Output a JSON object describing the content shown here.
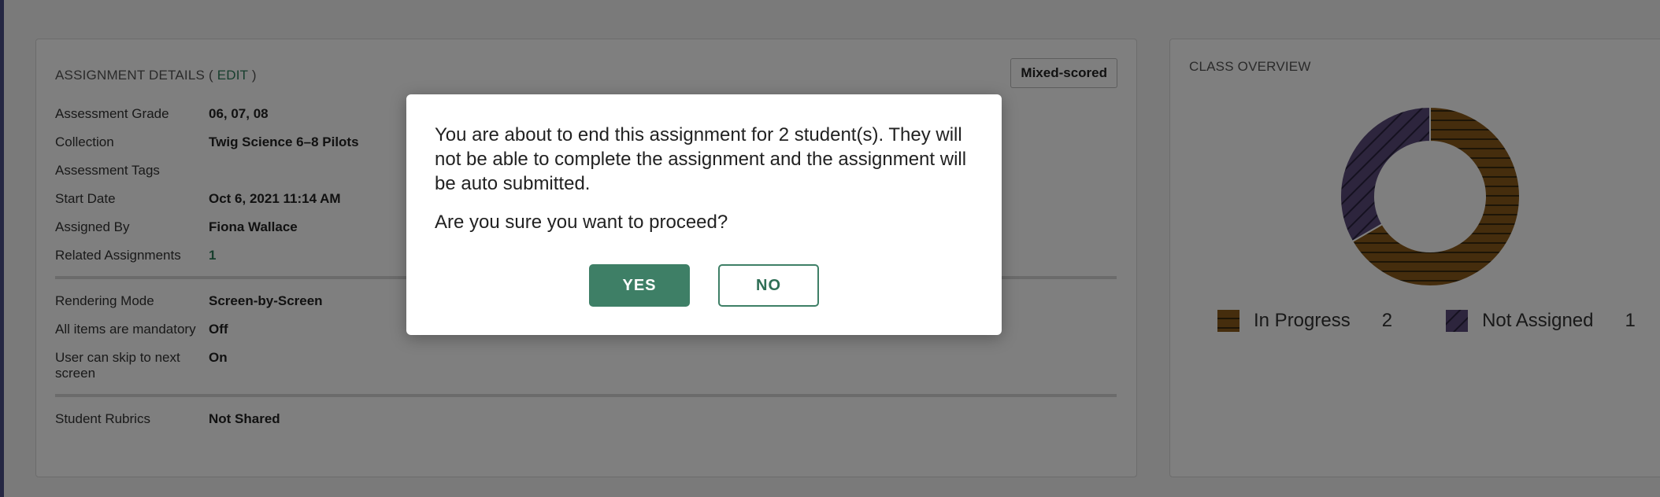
{
  "assignment_details": {
    "heading": "ASSIGNMENT DETAILS",
    "edit_open": " ( ",
    "edit_label": "EDIT",
    "edit_close": " )",
    "scoring_badge": "Mixed-scored",
    "rows": [
      {
        "label": "Assessment Grade",
        "value": "06, 07, 08"
      },
      {
        "label": "Collection",
        "value": "Twig Science 6–8 Pilots"
      },
      {
        "label": "Assessment Tags",
        "value": ""
      },
      {
        "label": "Start Date",
        "value": "Oct 6, 2021 11:14 AM"
      },
      {
        "label": "Assigned By",
        "value": "Fiona Wallace"
      },
      {
        "label": "Related Assignments",
        "value": "1"
      },
      {
        "label": "Rendering Mode",
        "value": "Screen-by-Screen"
      },
      {
        "label": "All items are mandatory",
        "value": "Off"
      },
      {
        "label": "User can skip to next screen",
        "value": "On"
      },
      {
        "label": "Student Rubrics",
        "value": "Not Shared"
      }
    ]
  },
  "class_overview": {
    "heading": "CLASS OVERVIEW",
    "chart": {
      "type": "donut",
      "segments": [
        {
          "label": "In Progress",
          "value": 2,
          "color": "#8b5a1b",
          "pattern": "horizontal-stripes"
        },
        {
          "label": "Not Assigned",
          "value": 1,
          "color": "#5a4a7a",
          "pattern": "diagonal-stripes"
        }
      ]
    },
    "legend": [
      {
        "label": "In Progress",
        "count": "2",
        "color": "#8b5a1b"
      },
      {
        "label": "Not Assigned",
        "count": "1",
        "color": "#5a4a7a"
      }
    ]
  },
  "modal": {
    "message": "You are about to end this assignment for 2 student(s). They will not be able to complete the assignment and the assignment will be auto submitted.",
    "question": "Are you sure you want to proceed?",
    "yes_label": "YES",
    "no_label": "NO"
  },
  "colors": {
    "accent": "#3e7f66",
    "link": "#2e7d5b",
    "sidebar_strip": "#4a4e86"
  }
}
